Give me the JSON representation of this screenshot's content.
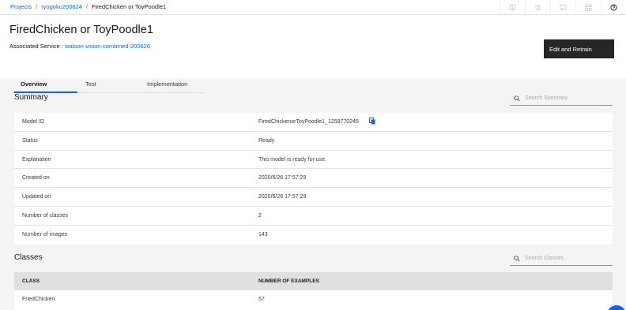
{
  "breadcrumb": {
    "items": [
      "Projects",
      "ryogoku200624",
      "FiredChicken or ToyPoodle1"
    ],
    "separator": "/"
  },
  "page": {
    "title": "FiredChicken or ToyPoodle1",
    "associated_label": "Associated Service : ",
    "associated_service": "watson-vision-combined-200626",
    "edit_retrain_label": "Edit and Retrain"
  },
  "tabs": [
    {
      "label": "Overview",
      "active": true
    },
    {
      "label": "Test",
      "active": false
    },
    {
      "label": "Implementation",
      "active": false
    }
  ],
  "summary": {
    "title": "Summary",
    "search_placeholder": "Search Summary",
    "rows": [
      {
        "key": "Model ID",
        "value": "FiredChickenorToyPoodle1_1259770245"
      },
      {
        "key": "Status",
        "value": "Ready"
      },
      {
        "key": "Explanation",
        "value": "This model is ready for use."
      },
      {
        "key": "Created on",
        "value": "2020/6/26 17:57:29"
      },
      {
        "key": "Updated on",
        "value": "2020/6/26 17:57:29"
      },
      {
        "key": "Number of classes",
        "value": "2"
      },
      {
        "key": "Number of images",
        "value": "143"
      }
    ]
  },
  "classes": {
    "title": "Classes",
    "search_placeholder": "Search Classes",
    "columns": [
      "CLASS",
      "NUMBER OF EXAMPLES"
    ],
    "rows": [
      {
        "class": "FriedChicken",
        "examples": "57"
      }
    ]
  },
  "icons": {
    "header": [
      "info-icon",
      "history-icon",
      "chat-icon",
      "grid-icon",
      "help-icon"
    ],
    "copy": "copy-icon",
    "search": "search-icon"
  },
  "colors": {
    "link": "#0f62fe",
    "button_bg": "#262626",
    "tab_active": "#0f62fe",
    "page_bg": "#f4f4f4"
  }
}
